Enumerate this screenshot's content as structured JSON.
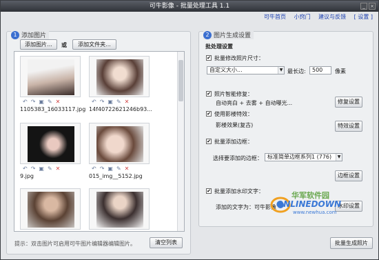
{
  "window": {
    "title": "可牛影像 - 批量处理工具 1.1"
  },
  "menu": [
    "可牛首页",
    "小窍门",
    "建议与反馈",
    "[ 设置 ]"
  ],
  "left": {
    "section_num": "1",
    "section_title": "添加图片",
    "add_image_btn": "添加图片...",
    "or_label": "或",
    "add_folder_btn": "添加文件夹...",
    "thumbnails": [
      {
        "name": "1105383_16033117.jpg"
      },
      {
        "name": "14f40722621246b93..."
      },
      {
        "name": "9.jpg"
      },
      {
        "name": "015_img__5152.jpg"
      },
      {
        "name": ""
      },
      {
        "name": ""
      }
    ],
    "hint": "提示：双击图片可启用可牛图片编辑器编辑图片。",
    "clear_btn": "清空列表"
  },
  "right": {
    "section_num": "2",
    "section_title": "图片生成设置",
    "heading": "批处理设置",
    "resize": {
      "label": "批量修改照片尺寸：",
      "checked": true,
      "preset": "自定义大小...",
      "long_side_label": "最长边:",
      "long_side_value": "500",
      "unit": "像素"
    },
    "repair": {
      "label": "照片智能修复：",
      "checked": true,
      "summary": "自动亮白 + 去雾 + 自动曝光...",
      "button": "修复设置"
    },
    "effect": {
      "label": "使用影楼特效：",
      "checked": true,
      "summary": "影楼效果(复古)",
      "button": "特效设置"
    },
    "border": {
      "label": "批量添加边框：",
      "checked": true,
      "choose_label": "选择要添加的边框：",
      "selected": "标准简单边框系列1 (776)",
      "button": "边框设置"
    },
    "watermark": {
      "label": "批量添加水印文字：",
      "checked": true,
      "text_label": "添加的文字为：可牛影像",
      "button": "水印设置"
    },
    "generate_btn": "批量生成照片"
  },
  "watermark_logo": {
    "line1": "华军软件园",
    "line2": "ONLINEDOWN",
    "line3": "www.newhua.com"
  }
}
